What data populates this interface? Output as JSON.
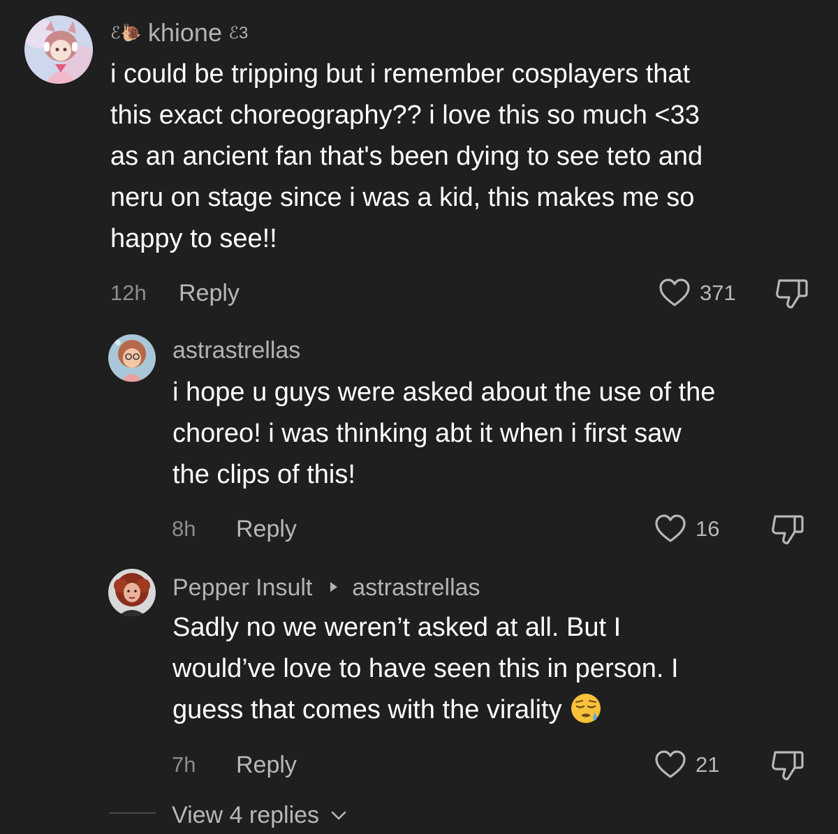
{
  "comments": [
    {
      "username": "khione",
      "username_prefix": "ℰ🐌",
      "username_suffix": "ℰ3",
      "text_lines": [
        "i could be tripping but i remember cosplayers that",
        "this exact choreography?? i love this so much <33",
        "as an ancient fan that's been dying to see teto and",
        "neru on stage since i was a kid, this makes me so",
        "happy to see!!"
      ],
      "time": "12h",
      "reply_label": "Reply",
      "likes": "371"
    },
    {
      "username": "astrastrellas",
      "text_lines": [
        "i hope u guys were asked about the use of the",
        "choreo! i was thinking abt it when i first saw",
        "the clips of this!"
      ],
      "time": "8h",
      "reply_label": "Reply",
      "likes": "16"
    },
    {
      "username": "Pepper Insult",
      "reply_to": "astrastrellas",
      "text_lines": [
        "Sadly no we weren’t asked at all. But I",
        "would’ve love to have seen this in person. I",
        "guess that comes with the virality"
      ],
      "emoji": "sleepy-face",
      "time": "7h",
      "reply_label": "Reply",
      "likes": "21"
    }
  ],
  "view_replies": "View 4 replies",
  "colors": {
    "background": "#1f1f1f",
    "text": "#ffffff",
    "muted": "#b3b3b3",
    "meta": "#8e8e8e"
  }
}
